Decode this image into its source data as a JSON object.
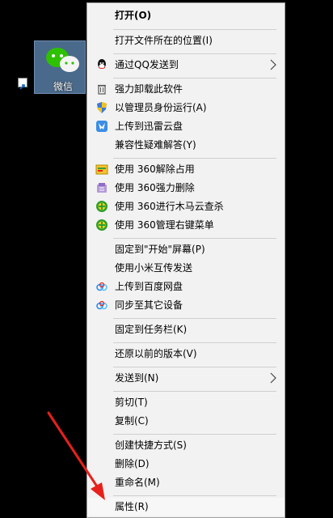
{
  "desktop_icon": {
    "label": "微信"
  },
  "menu": {
    "items": [
      {
        "label": "打开(O)",
        "icon": ""
      },
      {
        "label": "打开文件所在的位置(I)",
        "icon": ""
      },
      {
        "label": "通过QQ发送到",
        "icon": "qq-icon"
      },
      {
        "label": "强力卸载此软件",
        "icon": "trash-icon"
      },
      {
        "label": "以管理员身份运行(A)",
        "icon": "uac-shield-icon"
      },
      {
        "label": "上传到迅雷云盘",
        "icon": "xunlei-icon"
      },
      {
        "label": "兼容性疑难解答(Y)",
        "icon": ""
      },
      {
        "label": "使用 360解除占用",
        "icon": "360-unlock-icon"
      },
      {
        "label": "使用 360强力删除",
        "icon": "360-delete-icon"
      },
      {
        "label": "使用 360进行木马云查杀",
        "icon": "360-scan-icon"
      },
      {
        "label": "使用 360管理右键菜单",
        "icon": "360-menu-icon"
      },
      {
        "label": "固定到\"开始\"屏幕(P)",
        "icon": ""
      },
      {
        "label": "使用小米互传发送",
        "icon": ""
      },
      {
        "label": "上传到百度网盘",
        "icon": "baidu-netdisk-icon"
      },
      {
        "label": "同步至其它设备",
        "icon": "baidu-sync-icon"
      },
      {
        "label": "固定到任务栏(K)",
        "icon": ""
      },
      {
        "label": "还原以前的版本(V)",
        "icon": ""
      },
      {
        "label": "发送到(N)",
        "icon": ""
      },
      {
        "label": "剪切(T)",
        "icon": ""
      },
      {
        "label": "复制(C)",
        "icon": ""
      },
      {
        "label": "创建快捷方式(S)",
        "icon": ""
      },
      {
        "label": "删除(D)",
        "icon": ""
      },
      {
        "label": "重命名(M)",
        "icon": ""
      },
      {
        "label": "属性(R)",
        "icon": ""
      }
    ]
  },
  "colors": {
    "menu_bg": "#f2f2f2",
    "annotation_arrow": "#e8201c",
    "wechat_green": "#2dc100"
  }
}
